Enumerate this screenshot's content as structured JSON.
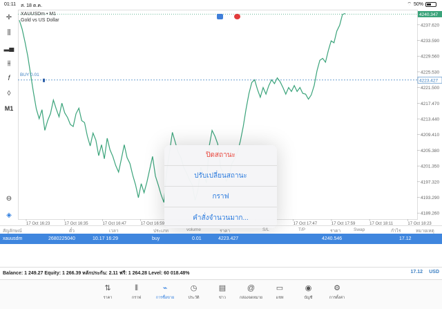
{
  "status_bar": {
    "time": "01:11",
    "date": "ส. 18 ต.ค.",
    "wifi_icon": "wifi-icon",
    "battery": "50%"
  },
  "toolbar": {
    "crosshair": "crosshair-icon",
    "candles": "candlestick-icon",
    "bars": "bar-chart-icon",
    "ohlc": "ohlc-icon",
    "indicators": "f",
    "objects": "objects-icon",
    "timeframe": "M1",
    "zoom": "zoom-icon",
    "trade": "trade-icon"
  },
  "chart": {
    "symbol_line": "XAUUSDm • M1",
    "symbol_desc": "Gold vs US Dollar",
    "buy_label": "BUY 0.01",
    "current_price_label": "4240.347",
    "buy_price_label": "4223.427"
  },
  "chart_data": {
    "type": "line",
    "y_ticks": [
      "4237.620",
      "4233.590",
      "4229.560",
      "4225.530",
      "4221.500",
      "4217.470",
      "4213.440",
      "4209.410",
      "4205.380",
      "4201.350",
      "4197.320",
      "4193.290",
      "4189.260"
    ],
    "x_ticks": [
      "17 Oct 16:23",
      "17 Oct 16:35",
      "17 Oct 16:47",
      "17 Oct 16:59",
      "",
      "",
      "",
      "17 Oct 17:47",
      "17 Oct 17:59",
      "17 Oct 18:11",
      "17 Oct 18:23"
    ],
    "ylim": [
      4187.7,
      4241.5
    ],
    "series": [
      {
        "values": [
          4238.8,
          4236.5,
          4233.2,
          4229.5,
          4224.8,
          4220.2,
          4216.0,
          4213.5,
          4215.8,
          4210.5,
          4213.0,
          4214.8,
          4218.3,
          4216.0,
          4214.0,
          4217.5,
          4215.0,
          4213.8,
          4212.0,
          4211.5,
          4214.8,
          4216.2,
          4213.0,
          4212.5,
          4209.0,
          4206.5,
          4209.8,
          4208.0,
          4204.0,
          4206.8,
          4203.2,
          4208.5,
          4205.5,
          4203.8,
          4201.5,
          4199.8,
          4203.2,
          4206.8,
          4203.5,
          4202.0,
          4199.0,
          4196.5,
          4193.2,
          4196.8,
          4194.5,
          4197.2,
          4200.5,
          4203.8,
          4198.8,
          4196.5,
          4194.0,
          4192.0,
          4200.0,
          4205.0,
          4210.0,
          4207.5,
          4205.0,
          4203.5,
          4201.0,
          4199.5,
          4197.8,
          4196.5,
          4192.5,
          4195.2,
          4201.0,
          4199.0,
          4197.0,
          4206.5,
          4210.5,
          4209.0,
          4207.0,
          4201.0,
          4199.5,
          4197.5,
          4198.8,
          4202.0,
          4203.2,
          4205.0,
          4207.8,
          4211.5,
          4216.0,
          4220.0,
          4222.8,
          4223.5,
          4221.0,
          4219.0,
          4221.5,
          4219.8,
          4222.0,
          4223.5,
          4222.5,
          4224.0,
          4223.0,
          4221.5,
          4219.8,
          4221.5,
          4220.5,
          4222.0,
          4220.5,
          4221.5,
          4220.0,
          4219.8,
          4218.5,
          4219.6,
          4222.0,
          4225.8,
          4228.5,
          4229.0,
          4228.0,
          4231.0,
          4233.5,
          4233.0,
          4236.0,
          4237.5,
          4240.3,
          4240.5
        ]
      }
    ],
    "buy_price": 4223.427,
    "current_price": 4240.347
  },
  "action_sheet": {
    "close": "ปิดสถานะ",
    "modify": "ปรับเปลี่ยนสถานะ",
    "chart": "กราฟ",
    "bulk": "คำสั่งจำนวนมาก..."
  },
  "trade_header": [
    "สัญลักษณ์",
    "ตั๋ว",
    "เวลา",
    "ประเภท",
    "volume",
    "ราคา",
    "S/L",
    "T/P",
    "ราคา",
    "Swap",
    "กำไร",
    "หมายเหตุ"
  ],
  "trade_row": {
    "symbol": "xauusdm",
    "ticket": "2680225040",
    "time": "10.17 16:29",
    "type": "buy",
    "volume": "0.01",
    "open_price": "4223.427",
    "price": "4240.546",
    "profit": "17.12"
  },
  "balance": {
    "text": "Balance: 1 249.27 Equity: 1 266.39 หลักประกัน: 2.11 ฟรี: 1 264.28 Level: 60 018.48%",
    "profit": "17.12",
    "currency": "USD"
  },
  "tabs": [
    {
      "label": "ราคา",
      "icon": "quotes-icon",
      "glyph": "⇅"
    },
    {
      "label": "กราฟ",
      "icon": "chart-icon",
      "glyph": "⫴"
    },
    {
      "label": "การซื้อขาย",
      "icon": "trade-tab-icon",
      "glyph": "⌁",
      "active": true
    },
    {
      "label": "ประวัติ",
      "icon": "history-icon",
      "glyph": "◷"
    },
    {
      "label": "ข่าว",
      "icon": "news-icon",
      "glyph": "▤"
    },
    {
      "label": "กล่องจดหมาย",
      "icon": "mailbox-icon",
      "glyph": "@"
    },
    {
      "label": "แชท",
      "icon": "chat-icon",
      "glyph": "▭"
    },
    {
      "label": "บัญชี",
      "icon": "account-icon",
      "glyph": "◉"
    },
    {
      "label": "การตั้งค่า",
      "icon": "settings-icon",
      "glyph": "⚙"
    }
  ],
  "colors": {
    "line": "#3aa37a",
    "accent": "#2b7bde",
    "row_bg": "#3f86de",
    "destructive": "#e8443a",
    "buy_line": "#3a7fc1"
  }
}
